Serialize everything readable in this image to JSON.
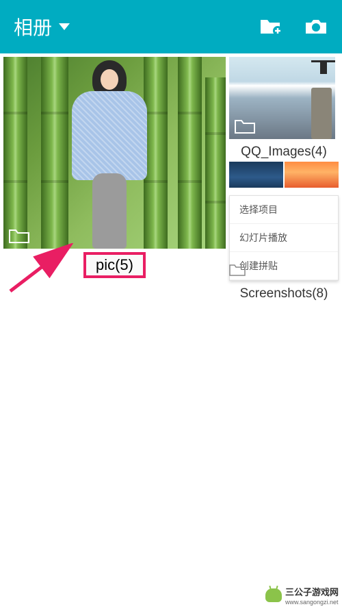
{
  "header": {
    "title": "相册"
  },
  "albums": {
    "main": {
      "label": "pic(5)"
    },
    "qq": {
      "label": "QQ_Images(4)"
    },
    "screenshots": {
      "label": "Screenshots(8)"
    }
  },
  "context_menu": {
    "items": [
      "选择项目",
      "幻灯片播放",
      "创建拼贴"
    ]
  },
  "watermark": {
    "name": "三公子游戏网",
    "url": "www.sangongzi.net"
  }
}
